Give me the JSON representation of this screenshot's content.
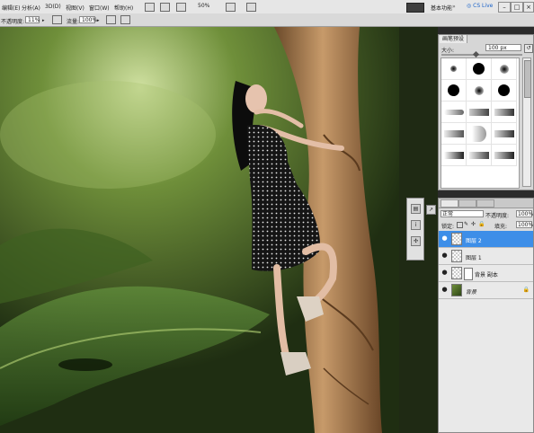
{
  "menubar": {
    "items": [
      "编辑(E)",
      "分析(A)",
      "3D(D)",
      "视图(V)",
      "窗口(W)",
      "帮助(H)"
    ],
    "zoom": "50%",
    "workspace": "基本功能",
    "cs_live": "CS Live"
  },
  "options_bar": {
    "opacity_label": "不透明度:",
    "opacity_value": "11%",
    "flow_label": "流量:",
    "flow_value": "100%"
  },
  "brush_panel": {
    "tab_label": "画笔预设",
    "size_label": "大小:",
    "size_value": "100 px"
  },
  "layers_panel": {
    "blend_mode": "正常",
    "opacity_label": "不透明度:",
    "opacity_value": "100%",
    "lock_label": "锁定:",
    "fill_label": "填充:",
    "fill_value": "100%",
    "layers": [
      {
        "name": "图层 2",
        "selected": true
      },
      {
        "name": "图层 1",
        "selected": false
      },
      {
        "name": "背景 副本",
        "selected": false
      },
      {
        "name": "背景",
        "selected": false,
        "locked": true
      }
    ]
  },
  "colors": {
    "selection": "#3d8ee8",
    "panel_bg": "#dcdcdc"
  }
}
